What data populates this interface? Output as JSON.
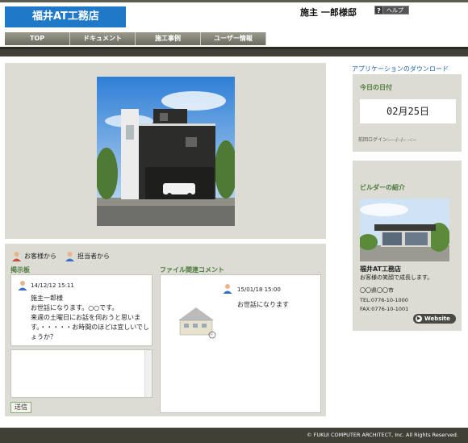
{
  "header": {
    "logo_text": "福井AT工務店",
    "owner_name": "施主 一郎様邸",
    "help_icon_glyph": "?",
    "help_label": "ヘルプ"
  },
  "nav": {
    "items": [
      {
        "label": "TOP"
      },
      {
        "label": "ドキュメント"
      },
      {
        "label": "施工事例"
      },
      {
        "label": "ユーザー情報"
      }
    ]
  },
  "communication": {
    "legend_customer": "お客様から",
    "legend_staff": "担当者から",
    "board_title": "掲示板",
    "post": {
      "date": "14/12/12 15:11",
      "body": "施主一郎様\nお世話になります。○○です。\n来週の土曜日にお話を伺おうと思います。・・・・・お時間のほどは宜しいでしょうか？"
    },
    "input_placeholder": "",
    "send_label": "送信",
    "file_title": "ファイル関連コメント",
    "file_comment": {
      "date": "15/01/18 15:00",
      "message": "お世話になります"
    }
  },
  "sidebar": {
    "download_link": "アプリケーションのダウンロード",
    "date_title": "今日の日付",
    "today": "02月25日",
    "last_login": "前回ログイン:----/--/-- --:--",
    "builder_title": "ビルダーの紹介",
    "builder_name": "福井AT工務店",
    "builder_tagline": "お客様の笑顔で成長します。",
    "builder_address": "〇〇県〇〇市",
    "builder_tel": "TEL:0776-10-1000",
    "builder_fax": "FAX:0776-10-1001",
    "website_label": "Website"
  },
  "footer": {
    "copyright": "© FUKUI COMPUTER ARCHITECT, Inc. All Rights Reserved."
  },
  "colors": {
    "brand_blue": "#1f78c8",
    "panel_gray": "#dcdcd4",
    "heading_green": "#4a7a3a",
    "dark_bar": "#404037"
  }
}
